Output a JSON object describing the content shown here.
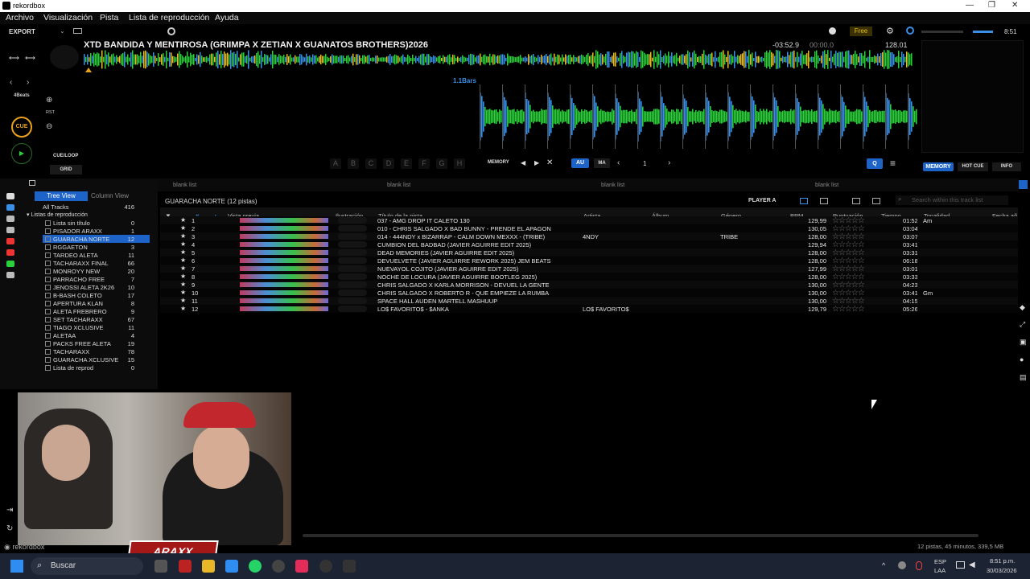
{
  "window": {
    "title": "rekordbox"
  },
  "menu": [
    "Archivo",
    "Visualización",
    "Pista",
    "Lista de reproducción",
    "Ayuda"
  ],
  "deck": {
    "export_label": "EXPORT",
    "track_title": "XTD BANDIDA Y MENTIROSA (GRIIMPA X ZETIAN X GUANATOS BROTHERS)2026",
    "remaining": "-03:52.9",
    "elapsed": "00:00.0",
    "bpm": "128.01",
    "time": "8:51",
    "free_label": "Free",
    "bars_label": "1.1Bars",
    "beats_label": "4Beats",
    "rst_label": "RST",
    "cue_label": "CUE",
    "cue_loop_label": "CUE/LOOP",
    "grid_label": "GRID",
    "pads": [
      "A",
      "B",
      "C",
      "D",
      "E",
      "F",
      "G",
      "H"
    ],
    "memory_label": "MEMORY",
    "au_label": "AU",
    "ma_label": "MA",
    "counter": "1",
    "memory_tab": "MEMORY",
    "hot_cue_tab": "HOT CUE",
    "info_tab": "INFO"
  },
  "sidebar": {
    "tree_view": "Tree View",
    "column_view": "Column View",
    "all_tracks": {
      "label": "All Tracks",
      "count": "416"
    },
    "playlists_header": "Listas de reproducción",
    "playlists": [
      {
        "label": "Lista sin título",
        "count": "0"
      },
      {
        "label": "PISADOR ARAXX",
        "count": "1"
      },
      {
        "label": "GUARACHA NORTE",
        "count": "12"
      },
      {
        "label": "RGGAETON",
        "count": "3"
      },
      {
        "label": "TARDEO ALETA",
        "count": "11"
      },
      {
        "label": "TACHARAXX FINAL",
        "count": "66"
      },
      {
        "label": "MONROYY NEW",
        "count": "20"
      },
      {
        "label": "PARRACHO FREE",
        "count": "7"
      },
      {
        "label": "JENOSSI ALETA 2K26",
        "count": "10"
      },
      {
        "label": "B-BASH COLETO",
        "count": "17"
      },
      {
        "label": "APERTURA KLAN",
        "count": "8"
      },
      {
        "label": "ALETA FREBRERO",
        "count": "9"
      },
      {
        "label": "SET TACHARAXX",
        "count": "67"
      },
      {
        "label": "TIAGO XCLUSIVE",
        "count": "11"
      },
      {
        "label": "ALETAA",
        "count": "4"
      },
      {
        "label": "PACKS FREE ALETA",
        "count": "19"
      },
      {
        "label": "TACHARAXX",
        "count": "78"
      },
      {
        "label": "GUARACHA XCLUSIVE",
        "count": "15"
      },
      {
        "label": "Lista de reprod",
        "count": "0"
      }
    ],
    "selected_index": 2
  },
  "tabs": [
    "blank list",
    "blank list",
    "blank list",
    "blank list"
  ],
  "tracklist": {
    "title": "GUARACHA NORTE (12 pistas)",
    "player_label": "PLAYER A",
    "search_placeholder": "Search within this track list",
    "columns": [
      "#",
      "Vista previa",
      "Ilustración",
      "Título de la pista",
      "Artista",
      "Álbum",
      "Género",
      "BPM",
      "Puntuación",
      "Tiempo",
      "Tonalidad",
      "Fecha añ"
    ],
    "rows": [
      {
        "n": "1",
        "title": "037 - AMG DROP IT CALETO 130",
        "artist": "",
        "genre": "",
        "bpm": "129,99",
        "time": "01:52",
        "key": "Am"
      },
      {
        "n": "2",
        "title": "010 - CHRIS SALGADO X BAD BUNNY - PRENDE EL APAGON",
        "artist": "",
        "genre": "",
        "bpm": "130,05",
        "time": "03:04",
        "key": ""
      },
      {
        "n": "3",
        "title": "014 - 444NDY x BIZARRAP - CALM DOWN MEXXX - (TRIBE)",
        "artist": "4NDY",
        "genre": "TRIBE",
        "bpm": "128,00",
        "time": "03:07",
        "key": ""
      },
      {
        "n": "4",
        "title": "CUMBION DEL BADBAD (JAVIER AGUIRRE EDIT 2025)",
        "artist": "",
        "genre": "",
        "bpm": "129,94",
        "time": "03:41",
        "key": ""
      },
      {
        "n": "5",
        "title": "DEAD MEMORIES (JAVIER AGUIRRE EDIT 2025)",
        "artist": "",
        "genre": "",
        "bpm": "128,00",
        "time": "03:31",
        "key": ""
      },
      {
        "n": "6",
        "title": "DEVUELVETE (JAVIER AGUIRRE REWORK 2025) JEM BEATS",
        "artist": "",
        "genre": "",
        "bpm": "128,00",
        "time": "06:18",
        "key": ""
      },
      {
        "n": "7",
        "title": "NUEVAYOL COJITO (JAVIER AGUIRRE EDIT 2025)",
        "artist": "",
        "genre": "",
        "bpm": "127,99",
        "time": "03:01",
        "key": ""
      },
      {
        "n": "8",
        "title": "NOCHE DE LOCURA (JAVIER AGUIRRE BOOTLEG 2025)",
        "artist": "",
        "genre": "",
        "bpm": "128,00",
        "time": "03:33",
        "key": ""
      },
      {
        "n": "9",
        "title": "CHRIS SALGADO X KARLA MORRISON - DEVUEL LA GENTE",
        "artist": "",
        "genre": "",
        "bpm": "130,00",
        "time": "04:23",
        "key": ""
      },
      {
        "n": "10",
        "title": "CHRIS SALGADO X ROBERTO R - QUE EMPIEZE LA RUMBA",
        "artist": "",
        "genre": "",
        "bpm": "130,00",
        "time": "03:41",
        "key": "Gm"
      },
      {
        "n": "11",
        "title": "SPACE HALL AUDEN MARTELL MASHUUP",
        "artist": "",
        "genre": "",
        "bpm": "130,00",
        "time": "04:15",
        "key": ""
      },
      {
        "n": "12",
        "title": "LO$ FAVORITO$ - $ANKA",
        "artist": "LO$ FAVORITO$",
        "genre": "",
        "bpm": "129,79",
        "time": "05:26",
        "key": ""
      }
    ],
    "status": "12 pistas, 45 minutos, 339,5 MB"
  },
  "brand_bottom": "rekordbox",
  "taskbar": {
    "search": "Buscar",
    "lang1": "ESP",
    "lang2": "LAA",
    "clock": "8:51 p.m.",
    "date": "30/03/2026"
  },
  "colors": {
    "accent": "#1e64c8",
    "cue": "#e8a21a",
    "free": "#e8c020",
    "wave_green": "#2bd13b",
    "wave_blue": "#3a8fe6"
  }
}
